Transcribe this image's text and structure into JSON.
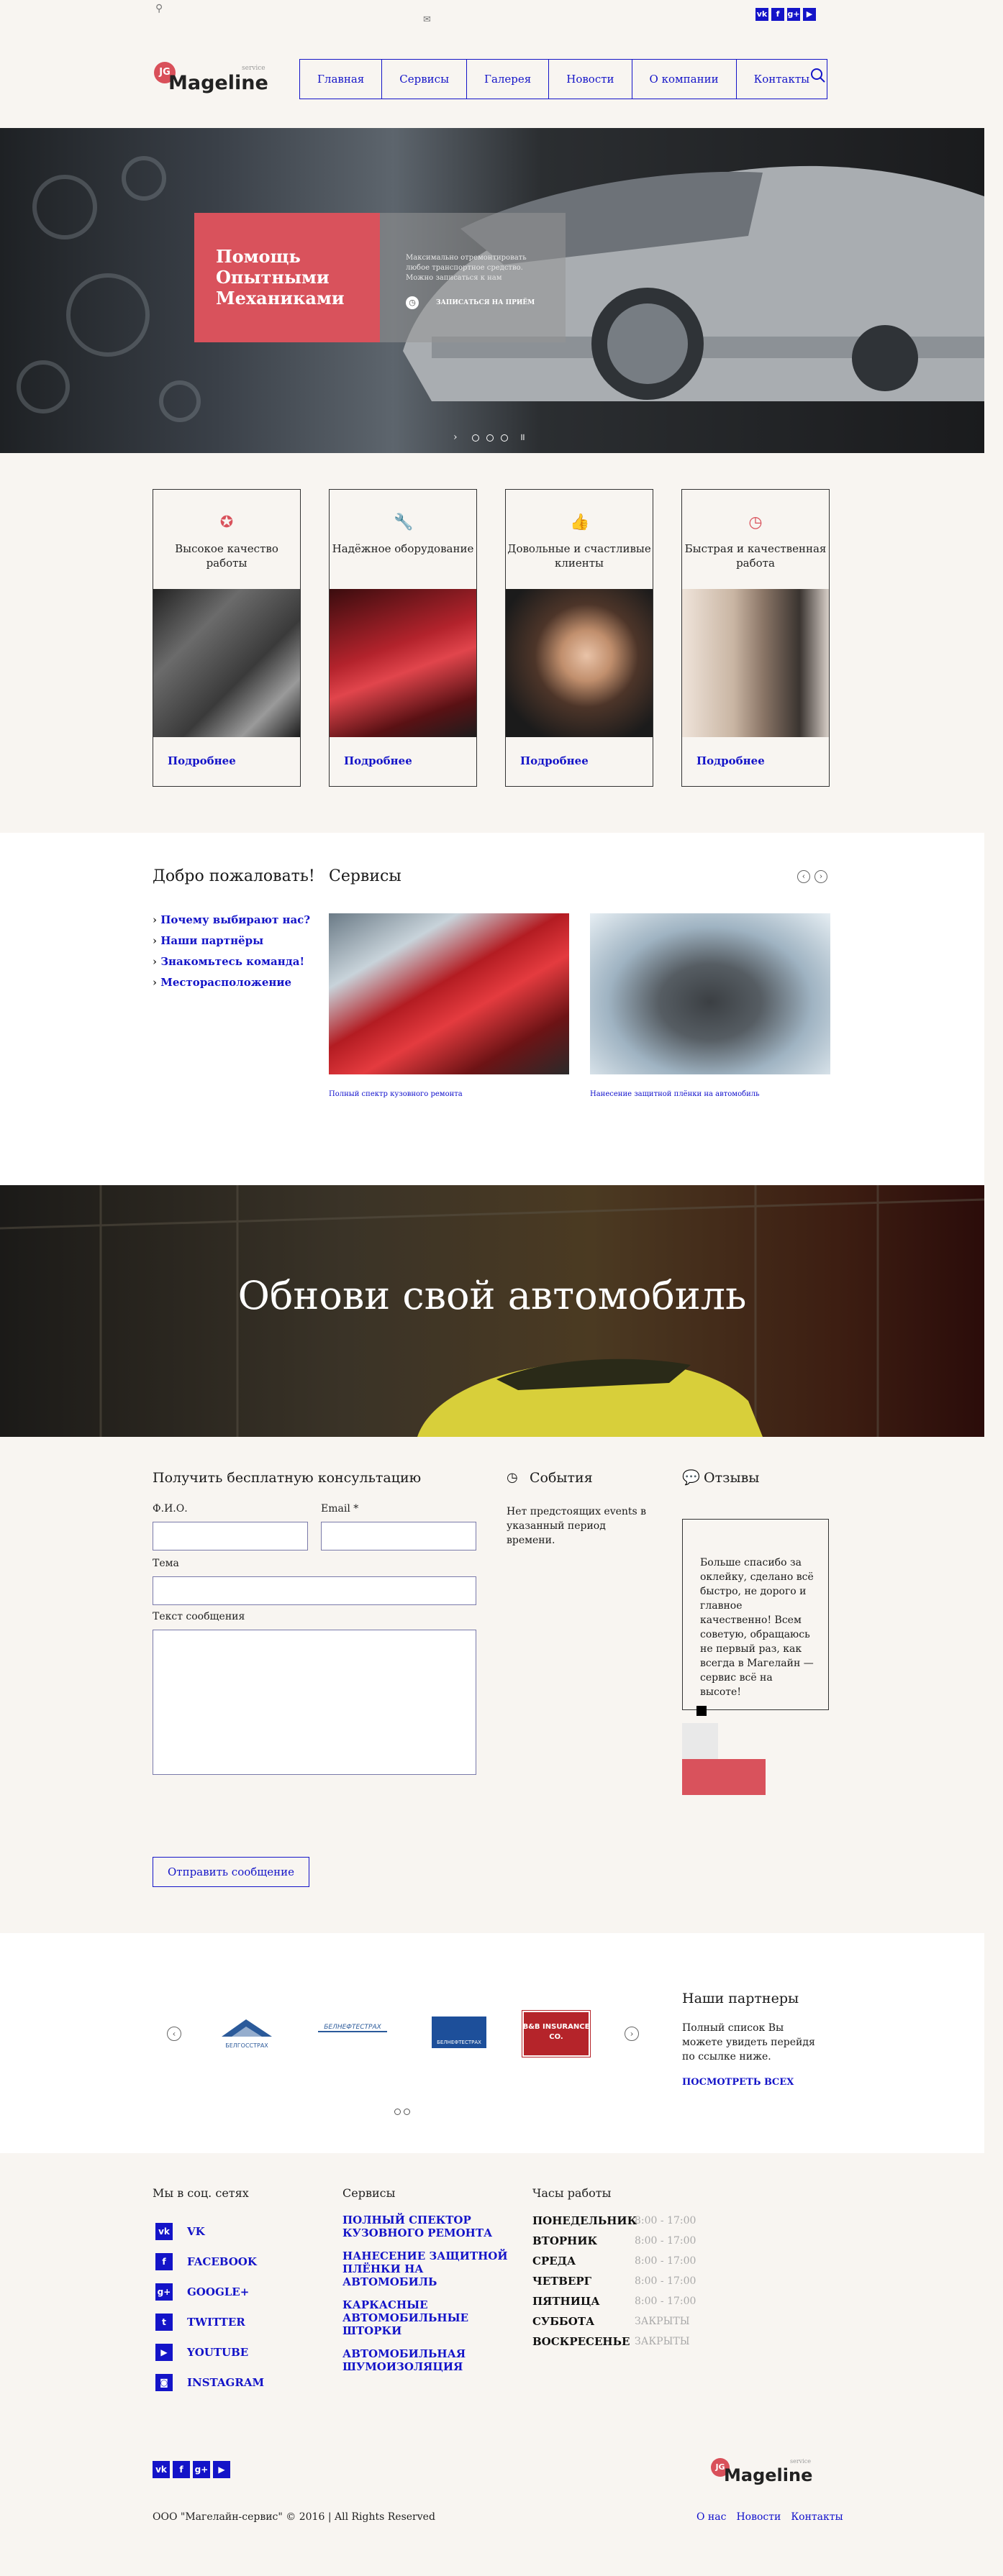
{
  "topbar": {
    "address": "",
    "email": "",
    "social": [
      "VK",
      "FACEBOOK",
      "GOOGLE+",
      "YOUTUBE"
    ]
  },
  "header": {
    "logo_text": "Mageline",
    "logo_sup": "service",
    "nav": [
      "Главная",
      "Сервисы",
      "Галерея",
      "Новости",
      "О компании",
      "Контакты"
    ]
  },
  "hero": {
    "title": "Помощь Опытными Механиками",
    "text": "Максимально отремонтировать любое транспортное средство. Можно записаться к нам",
    "cta": "ЗАПИСАТЬСЯ НА ПРИЁМ"
  },
  "features": [
    {
      "title": "Высокое качество работы",
      "more": "Подробнее",
      "icon": "award-icon"
    },
    {
      "title": "Надёжное оборудование",
      "more": "Подробнее",
      "icon": "wrench-icon"
    },
    {
      "title": "Довольные и счастливые клиенты",
      "more": "Подробнее",
      "icon": "thumbs-up-icon"
    },
    {
      "title": "Быстрая и качественная работа",
      "more": "Подробнее",
      "icon": "clock-icon"
    }
  ],
  "welcome": {
    "title": "Добро пожаловать!",
    "items": [
      "Почему выбирают нас?",
      "Наши партнёры",
      "Знакомьтесь команда!",
      "Месторасположение"
    ]
  },
  "services": {
    "title": "Сервисы",
    "items": [
      {
        "caption": "Полный спектр кузовного ремонта"
      },
      {
        "caption": "Нанесение защитной плёнки на автомобиль"
      }
    ]
  },
  "banner": {
    "title": "Обнови свой автомобиль"
  },
  "consult": {
    "title": "Получить бесплатную консультацию",
    "fio": "Ф.И.О.",
    "email": "Email *",
    "subject": "Тема",
    "message": "Текст сообщения",
    "submit": "Отправить сообщение"
  },
  "events": {
    "title": "События",
    "empty": "Нет предстоящих events в указанный период времени."
  },
  "reviews": {
    "title": "Отзывы",
    "text": "Больше спасибо за оклейку, сделано всё быстро, не дорого и главное качественно! Всем советую, обращаюсь не первый раз, как всегда в Магелайн — сервис всё на высоте!"
  },
  "partners": {
    "title": "Наши партнеры",
    "text": "Полный список Вы можете увидеть перейдя по ссылке ниже.",
    "link": "ПОСМОТРЕТЬ ВСЕХ",
    "logos": [
      "БЕЛГОССТРАХ",
      "БЕЛНЕФТЕСТРАХ",
      "БЕЛНЕФТЕСТРАХ",
      "B&B INSURANCE CO."
    ]
  },
  "footer": {
    "social_title": "Мы в соц. сетях",
    "social": [
      "VK",
      "FACEBOOK",
      "GOOGLE+",
      "TWITTER",
      "YOUTUBE",
      "INSTAGRAM"
    ],
    "services_title": "Сервисы",
    "services": [
      "ПОЛНЫЙ СПЕКТОР КУЗОВНОГО РЕМОНТА",
      "НАНЕСЕНИЕ ЗАЩИТНОЙ ПЛЁНКИ НА АВТОМОБИЛЬ",
      "КАРКАСНЫЕ АВТОМОБИЛЬНЫЕ ШТОРКИ",
      "АВТОМОБИЛЬНАЯ ШУМОИЗОЛЯЦИЯ"
    ],
    "hours_title": "Часы работы",
    "hours": [
      {
        "day": "ПОНЕДЕЛЬНИК",
        "time": "8:00 - 17:00"
      },
      {
        "day": "ВТОРНИК",
        "time": "8:00 - 17:00"
      },
      {
        "day": "СРЕДА",
        "time": "8:00 - 17:00"
      },
      {
        "day": "ЧЕТВЕРГ",
        "time": "8:00 - 17:00"
      },
      {
        "day": "ПЯТНИЦА",
        "time": "8:00 - 17:00"
      },
      {
        "day": "СУББОТА",
        "time": "ЗАКРЫТЫ"
      },
      {
        "day": "ВОСКРЕСЕНЬЕ",
        "time": "ЗАКРЫТЫ"
      }
    ],
    "copyright": "ООО \"Магелайн-сервис\" © 2016 | All Rights Reserved",
    "links": [
      "О нас",
      "Новости",
      "Контакты"
    ]
  },
  "colors": {
    "accent": "#d9525c",
    "link": "#1414c8",
    "bg": "#f8f5f1"
  }
}
